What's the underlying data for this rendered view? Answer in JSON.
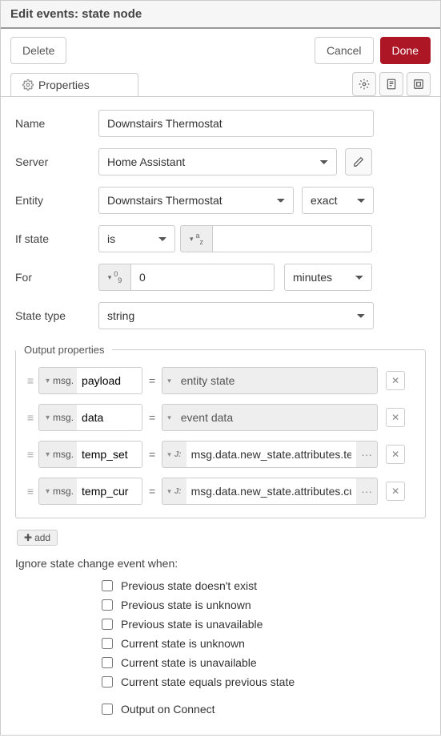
{
  "header": {
    "title": "Edit events: state node"
  },
  "buttons": {
    "delete": "Delete",
    "cancel": "Cancel",
    "done": "Done"
  },
  "tabs": {
    "properties": "Properties"
  },
  "form": {
    "name_label": "Name",
    "name_value": "Downstairs Thermostat",
    "server_label": "Server",
    "server_value": "Home Assistant",
    "entity_label": "Entity",
    "entity_value": "Downstairs Thermostat",
    "entity_mode": "exact",
    "ifstate_label": "If state",
    "ifstate_op": "is",
    "ifstate_value": "",
    "for_label": "For",
    "for_value": "0",
    "for_units": "minutes",
    "statetype_label": "State type",
    "statetype_value": "string"
  },
  "output": {
    "legend": "Output properties",
    "rows": [
      {
        "msg_prefix": "msg.",
        "msg_key": "payload",
        "val_type": "plain",
        "val": "entity state"
      },
      {
        "msg_prefix": "msg.",
        "msg_key": "data",
        "val_type": "plain",
        "val": "event data"
      },
      {
        "msg_prefix": "msg.",
        "msg_key": "temp_set",
        "val_type": "jsonata",
        "val": "msg.data.new_state.attributes.te"
      },
      {
        "msg_prefix": "msg.",
        "msg_key": "temp_cur",
        "val_type": "jsonata",
        "val": "msg.data.new_state.attributes.cu"
      }
    ],
    "add": "add"
  },
  "ignore": {
    "label": "Ignore state change event when:",
    "items": [
      "Previous state doesn't exist",
      "Previous state is unknown",
      "Previous state is unavailable",
      "Current state is unknown",
      "Current state is unavailable",
      "Current state equals previous state"
    ]
  },
  "output_on_connect": "Output on Connect"
}
